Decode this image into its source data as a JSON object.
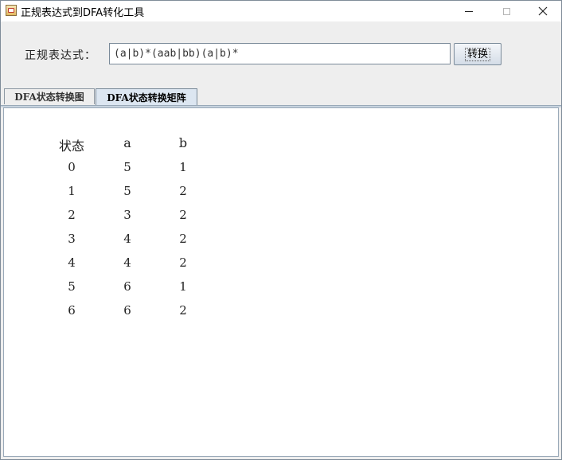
{
  "window": {
    "title": "正规表达式到DFA转化工具",
    "icon": "java-app-icon",
    "controls": [
      "minimize-icon",
      "maximize-icon",
      "close-icon"
    ]
  },
  "form": {
    "label": "正规表达式：",
    "input_value": "(a|b)*(aab|bb)(a|b)*",
    "button_label": "转换"
  },
  "tabs": [
    {
      "label": "DFA状态转换图",
      "selected": false
    },
    {
      "label": "DFA状态转换矩阵",
      "selected": true
    }
  ],
  "matrix": {
    "headers": [
      "状态",
      "a",
      "b"
    ],
    "rows": [
      [
        "0",
        "5",
        "1"
      ],
      [
        "1",
        "5",
        "2"
      ],
      [
        "2",
        "3",
        "2"
      ],
      [
        "3",
        "4",
        "2"
      ],
      [
        "4",
        "4",
        "2"
      ],
      [
        "5",
        "6",
        "1"
      ],
      [
        "6",
        "6",
        "2"
      ]
    ]
  },
  "colors": {
    "selected_tab": "#dce6f1",
    "border": "#7a8a99"
  }
}
